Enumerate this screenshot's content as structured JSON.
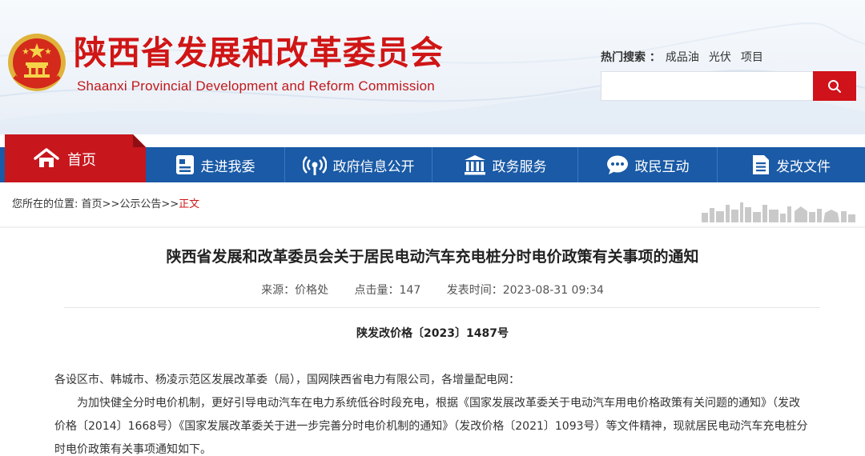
{
  "header": {
    "title": "陕西省发展和改革委员会",
    "subtitle": "Shaanxi Provincial Development and Reform Commission",
    "hot_search_label": "热门搜索 ：",
    "hot_search_links": [
      "成品油",
      "光伏",
      "项目"
    ],
    "search_placeholder": "",
    "search_button_icon": "search-icon"
  },
  "nav": {
    "home": "首页",
    "items": [
      {
        "label": "走进我委",
        "icon": "document-icon"
      },
      {
        "label": "政府信息公开",
        "icon": "broadcast-icon"
      },
      {
        "label": "政务服务",
        "icon": "building-icon"
      },
      {
        "label": "政民互动",
        "icon": "chat-icon"
      },
      {
        "label": "发改文件",
        "icon": "file-icon"
      }
    ]
  },
  "breadcrumb": {
    "prefix": "您所在的位置:",
    "items": [
      "首页",
      "公示公告"
    ],
    "separator": ">>",
    "current": "正文"
  },
  "article": {
    "title": "陕西省发展和改革委员会关于居民电动汽车充电桩分时电价政策有关事项的通知",
    "source": "来源：价格处",
    "hits": "点击量：147",
    "published": "发表时间：2023-08-31 09:34",
    "doc_number": "陕发改价格〔2023〕1487号",
    "recipients": "各设区市、韩城市、杨凌示范区发展改革委（局），国网陕西省电力有限公司，各增量配电网：",
    "paragraph1": "为加快健全分时电价机制，更好引导电动汽车在电力系统低谷时段充电，根据《国家发展改革委关于电动汽车用电价格政策有关问题的通知》（发改价格〔2014〕1668号）《国家发展改革委关于进一步完善分时电价机制的通知》（发改价格〔2021〕1093号）等文件精神，现就居民电动汽车充电桩分时电价政策有关事项通知如下。"
  },
  "colors": {
    "brand_red": "#d01515",
    "nav_blue": "#1a5aa6",
    "home_tab_red": "#c8161d"
  }
}
